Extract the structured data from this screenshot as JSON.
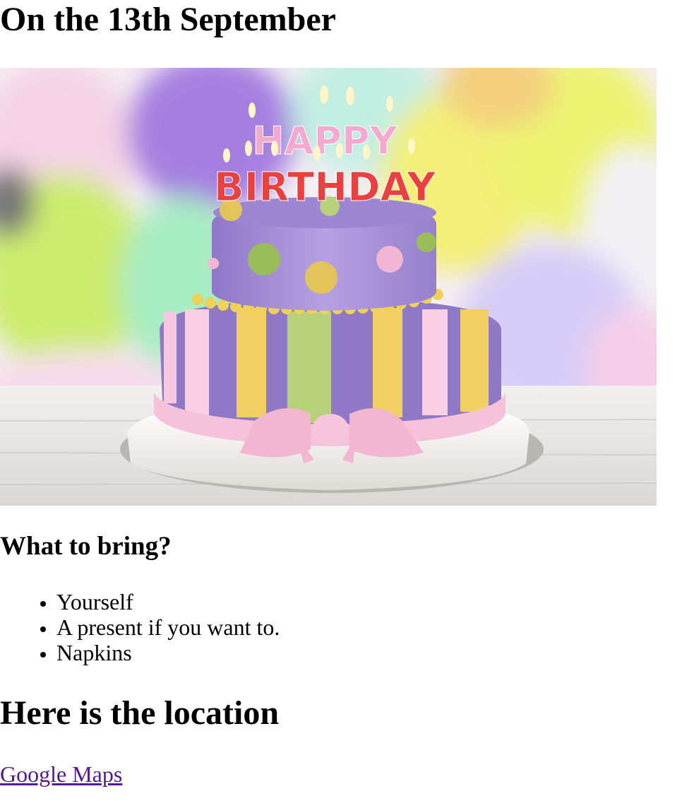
{
  "page": {
    "date_heading": "On the 13th September",
    "image_alt": "Birthday cake",
    "cake_candles_top": "HAPPY",
    "cake_candles_bottom": "BIRTHDAY",
    "bring_heading": "What to bring?",
    "bring_items": [
      "Yourself",
      "A present if you want to.",
      "Napkins"
    ],
    "location_heading": "Here is the location",
    "maps_link": "Google Maps"
  },
  "colors": {
    "visited_link": "#551a8b",
    "text": "#000000"
  }
}
